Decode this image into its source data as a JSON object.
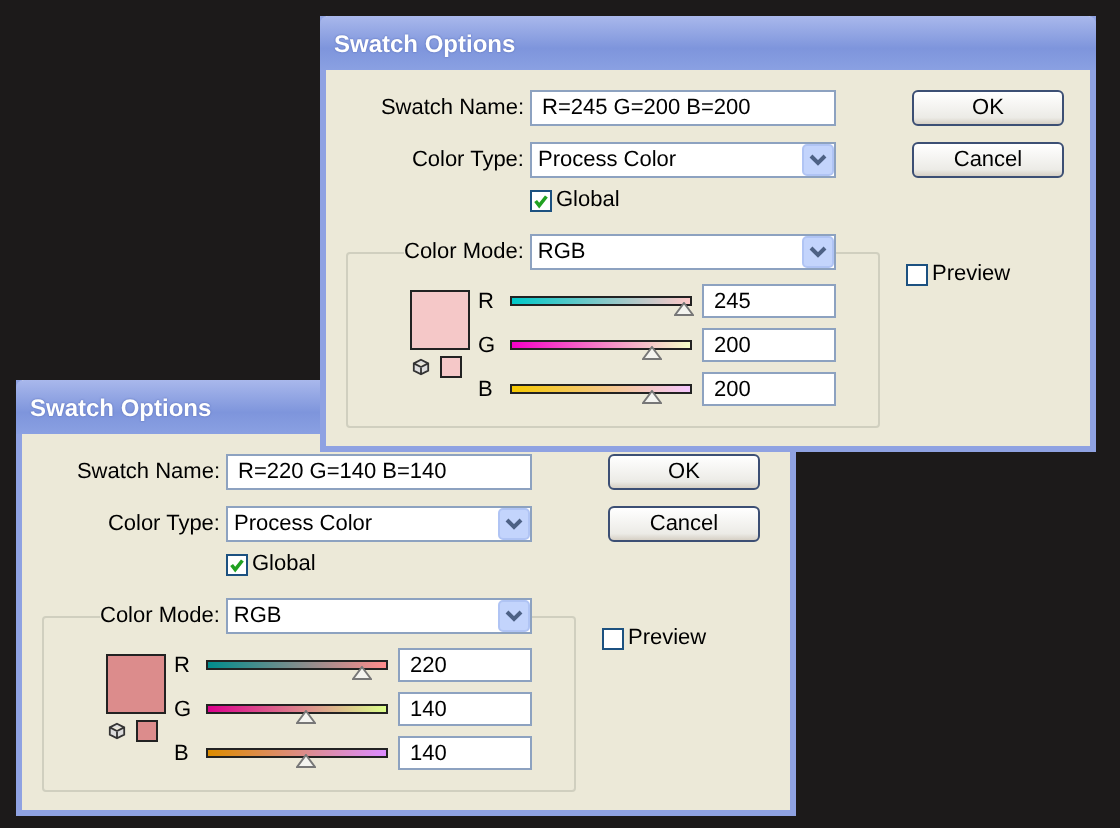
{
  "dialogs": [
    {
      "title": "Swatch Options",
      "color": "#f5c8c8",
      "swatch_name_label": "Swatch Name:",
      "swatch_name": "R=245 G=200 B=200",
      "color_type_label": "Color Type:",
      "color_type": "Process Color",
      "global": {
        "label": "Global",
        "checked": true
      },
      "color_mode_label": "Color Mode:",
      "color_mode": "RGB",
      "preview": {
        "label": "Preview",
        "checked": false
      },
      "channels": [
        {
          "name": "R",
          "value": "245",
          "level": 0.96
        },
        {
          "name": "G",
          "value": "200",
          "level": 0.78
        },
        {
          "name": "B",
          "value": "200",
          "level": 0.78
        }
      ],
      "buttons": [
        "OK",
        "Cancel"
      ]
    },
    {
      "title": "Swatch Options",
      "color": "#dc8c8c",
      "swatch_name_label": "Swatch Name:",
      "swatch_name": "R=220 G=140 B=140",
      "color_type_label": "Color Type:",
      "color_type": "Process Color",
      "global": {
        "label": "Global",
        "checked": true
      },
      "color_mode_label": "Color Mode:",
      "color_mode": "RGB",
      "preview": {
        "label": "Preview",
        "checked": false
      },
      "channels": [
        {
          "name": "R",
          "value": "220",
          "level": 0.86
        },
        {
          "name": "G",
          "value": "140",
          "level": 0.55
        },
        {
          "name": "B",
          "value": "140",
          "level": 0.55
        }
      ],
      "buttons": [
        "OK",
        "Cancel"
      ]
    }
  ]
}
